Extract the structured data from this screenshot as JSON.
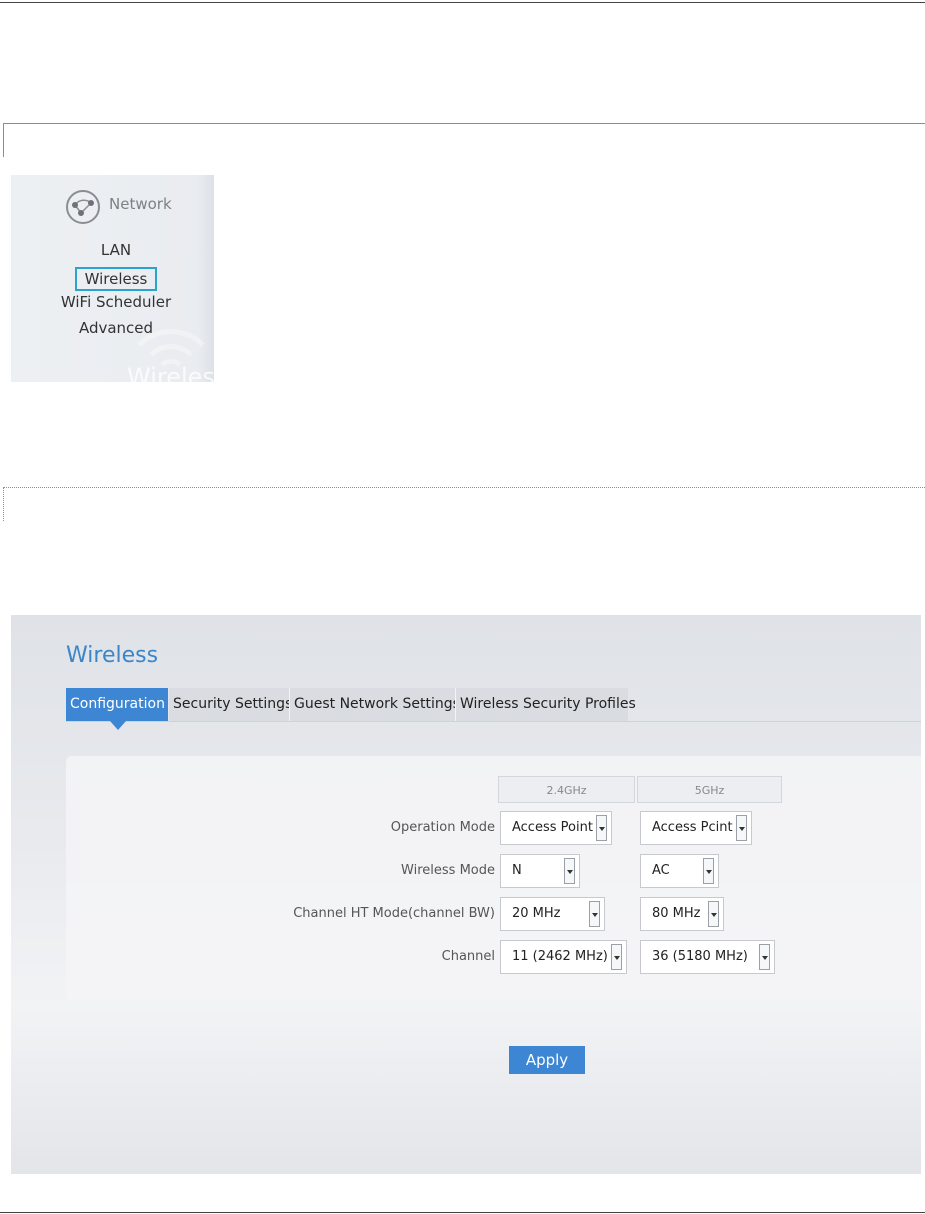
{
  "network_menu": {
    "title": "Network",
    "items": [
      {
        "label": "LAN"
      },
      {
        "label": "Wireless",
        "selected": true
      },
      {
        "label": "WiFi Scheduler"
      },
      {
        "label": "Advanced"
      }
    ],
    "watermark": "Wireless",
    "highlight_color": "#2aa3cf"
  },
  "wireless": {
    "title": "Wireless",
    "tabs": [
      {
        "label": "Configuration",
        "active": true
      },
      {
        "label": "Security Settings"
      },
      {
        "label": "Guest Network Settings"
      },
      {
        "label": "Wireless Security Profiles"
      }
    ],
    "bands": [
      "2.4GHz",
      "5GHz"
    ],
    "rows": [
      {
        "label": "Operation Mode",
        "values": [
          "Access Point",
          "Access Pcint"
        ]
      },
      {
        "label": "Wireless Mode",
        "values": [
          "N",
          "AC"
        ]
      },
      {
        "label": "Channel HT Mode(channel BW)",
        "values": [
          "20 MHz",
          "80 MHz"
        ]
      },
      {
        "label": "Channel",
        "values": [
          "11 (2462 MHz)",
          "36 (5180 MHz)"
        ]
      }
    ],
    "apply_label": "Apply",
    "accent_color": "#3d86d3"
  }
}
